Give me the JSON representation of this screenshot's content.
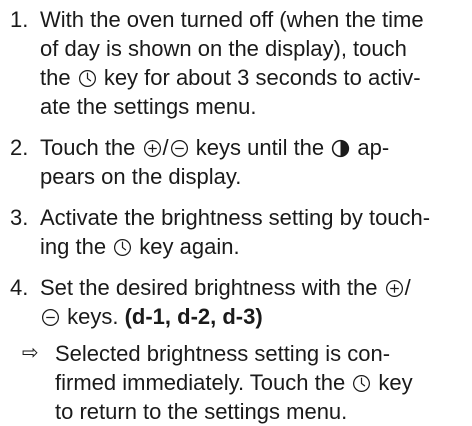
{
  "steps": [
    {
      "number": "1.",
      "lines": [
        "With the oven turned off (when the time",
        "of day is shown on the display), touch",
        {
          "before": "the ",
          "icon": "clock-icon",
          "after": " key for about 3 seconds to activ-"
        },
        "ate the settings menu."
      ]
    },
    {
      "number": "2.",
      "lines": [
        {
          "before": "Touch the ",
          "icon": "plus-icon",
          "mid": "/",
          "icon2": "minus-icon",
          "after": " keys until the ",
          "icon3": "half-circle-icon",
          "after2": " ap-"
        },
        "pears on the display."
      ]
    },
    {
      "number": "3.",
      "lines": [
        "Activate the brightness setting by touch-",
        {
          "before": "ing the ",
          "icon": "clock-icon",
          "after": " key again."
        }
      ]
    },
    {
      "number": "4.",
      "lines": [
        {
          "before": "Set the desired brightness with the ",
          "icon": "plus-icon",
          "after": "/"
        },
        {
          "icon": "minus-icon",
          "after": " keys. ",
          "bold": "(d-1, d-2, d-3)"
        }
      ]
    }
  ],
  "result": {
    "arrow": "⇨",
    "lines": [
      "Selected brightness setting is con-",
      {
        "before": "firmed immediately. Touch the ",
        "icon": "clock-icon",
        "after": " key"
      },
      "to return to the settings menu."
    ]
  }
}
